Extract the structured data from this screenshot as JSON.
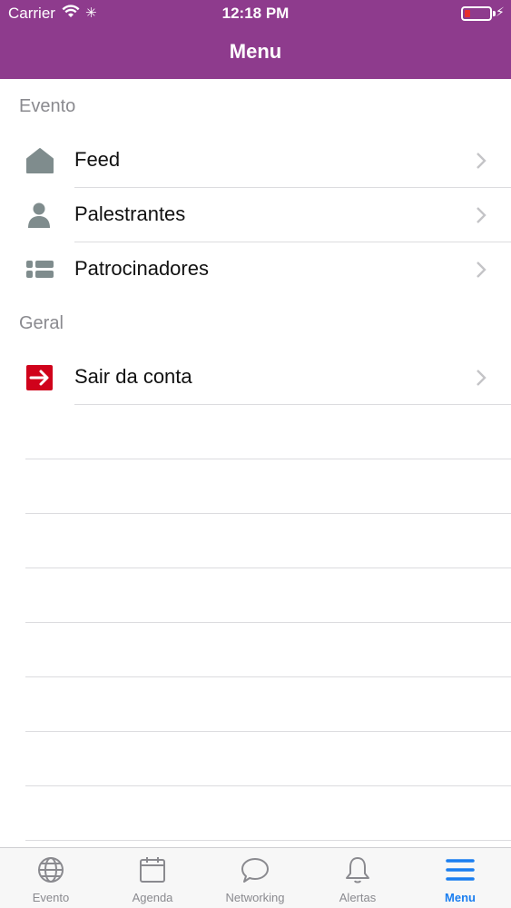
{
  "status_bar": {
    "carrier": "Carrier",
    "time": "12:18 PM"
  },
  "nav": {
    "title": "Menu"
  },
  "sections": [
    {
      "header": "Evento",
      "items": [
        {
          "label": "Feed",
          "icon": "home-icon"
        },
        {
          "label": "Palestrantes",
          "icon": "person-icon"
        },
        {
          "label": "Patrocinadores",
          "icon": "list-icon"
        }
      ]
    },
    {
      "header": "Geral",
      "items": [
        {
          "label": "Sair da conta",
          "icon": "logout-icon"
        }
      ]
    }
  ],
  "tab_bar": {
    "items": [
      {
        "label": "Evento",
        "icon": "globe-icon"
      },
      {
        "label": "Agenda",
        "icon": "calendar-icon"
      },
      {
        "label": "Networking",
        "icon": "chat-bubble-icon"
      },
      {
        "label": "Alertas",
        "icon": "bell-icon"
      },
      {
        "label": "Menu",
        "icon": "menu-icon"
      }
    ],
    "active": "Menu"
  },
  "colors": {
    "brand": "#8e3b8d",
    "active_tab": "#1a7ef0",
    "icon_gray": "#7f8c8d",
    "logout_red": "#d0021b",
    "battery_low": "#e6302d"
  }
}
